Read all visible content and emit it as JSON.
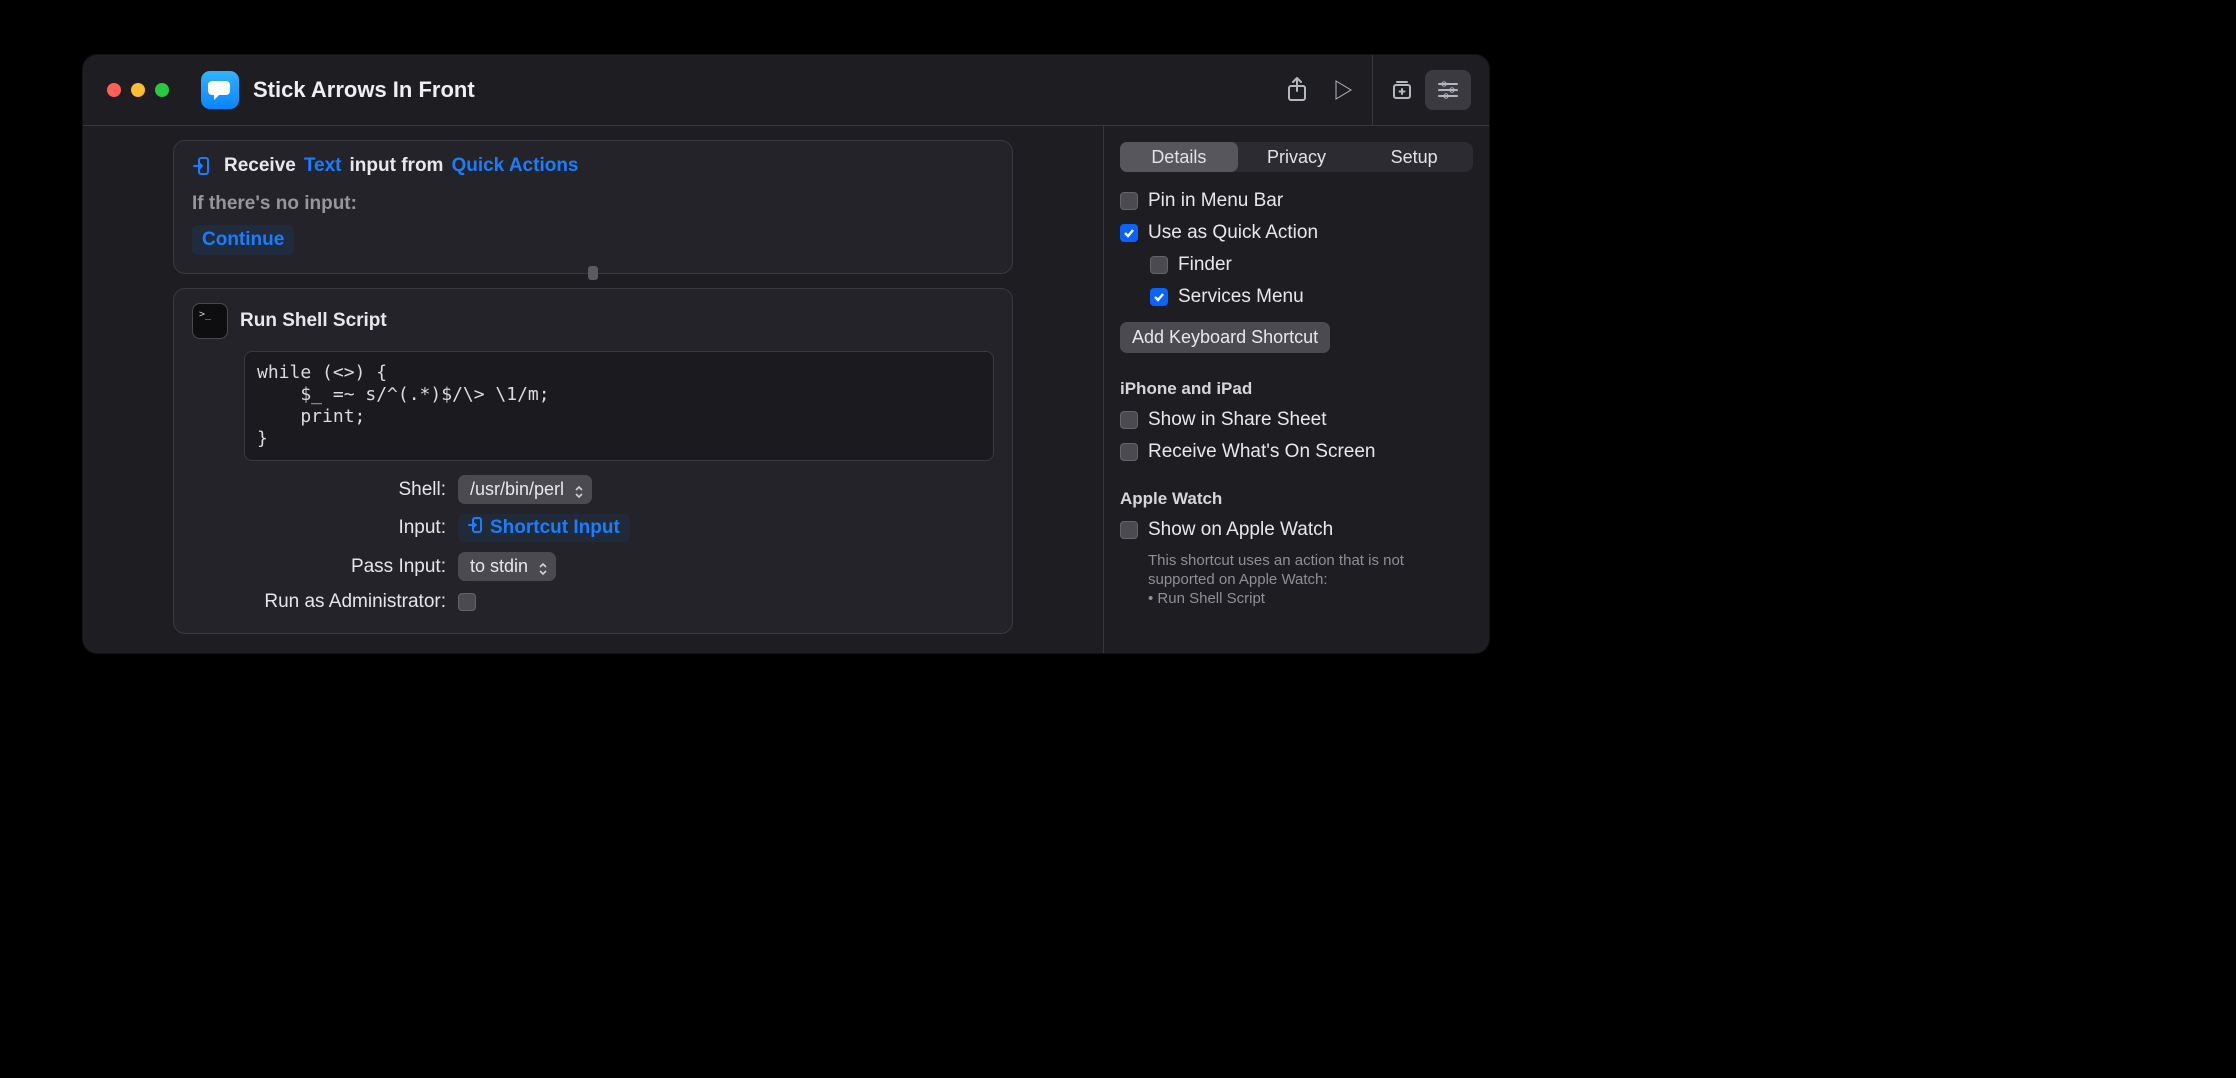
{
  "title": "Stick Arrows In Front",
  "receive": {
    "word_receive": "Receive",
    "type_link": "Text",
    "word_from": "input from",
    "source_link": "Quick Actions",
    "no_input_label": "If there's no input:",
    "fallback": "Continue"
  },
  "shell_action": {
    "title": "Run Shell Script",
    "code": "while (<>) {\n    $_ =~ s/^(.*)$/\\> \\1/m;\n    print;\n}",
    "labels": {
      "shell": "Shell:",
      "input": "Input:",
      "pass_input": "Pass Input:",
      "run_admin": "Run as Administrator:"
    },
    "shell_value": "/usr/bin/perl",
    "input_token": "Shortcut Input",
    "pass_input_value": "to stdin",
    "run_admin_checked": false
  },
  "sidebar": {
    "tabs": [
      "Details",
      "Privacy",
      "Setup"
    ],
    "active_tab": 0,
    "options": {
      "pin_menubar": {
        "label": "Pin in Menu Bar",
        "checked": false
      },
      "quick_action": {
        "label": "Use as Quick Action",
        "checked": true
      },
      "finder": {
        "label": "Finder",
        "checked": false
      },
      "services_menu": {
        "label": "Services Menu",
        "checked": true
      },
      "add_kb_shortcut": "Add Keyboard Shortcut",
      "heading_ios": "iPhone and iPad",
      "share_sheet": {
        "label": "Show in Share Sheet",
        "checked": false
      },
      "receive_screen": {
        "label": "Receive What's On Screen",
        "checked": false
      },
      "heading_watch": "Apple Watch",
      "show_watch": {
        "label": "Show on Apple Watch",
        "checked": false
      },
      "watch_note_line1": "This shortcut uses an action that is not supported on Apple Watch:",
      "watch_note_line2": "• Run Shell Script"
    }
  }
}
